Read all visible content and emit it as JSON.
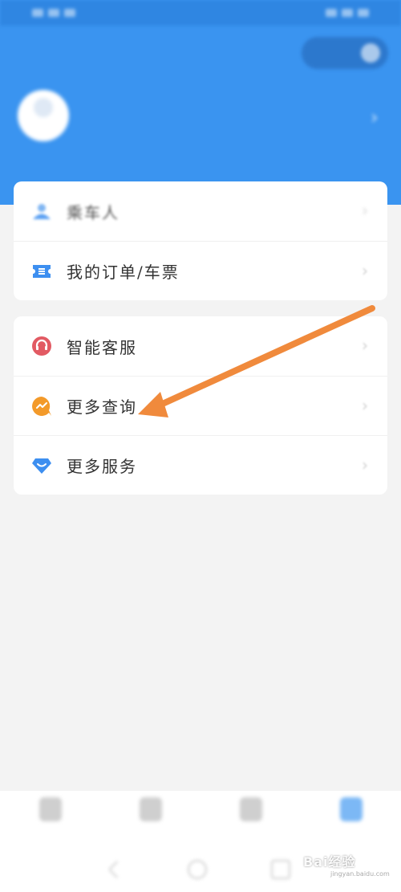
{
  "status_bar": {
    "left": "",
    "right": ""
  },
  "header": {
    "title": "",
    "pill_label": ""
  },
  "profile": {
    "name": "",
    "subtitle": ""
  },
  "menu_group_1": [
    {
      "label": "乘车人",
      "icon": "passenger-icon"
    },
    {
      "label": "我的订单/车票",
      "icon": "ticket-icon"
    }
  ],
  "menu_group_2": [
    {
      "label": "智能客服",
      "icon": "headset-icon"
    },
    {
      "label": "更多查询",
      "icon": "chart-bubble-icon"
    },
    {
      "label": "更多服务",
      "icon": "diamond-icon"
    }
  ],
  "bottom_nav": [
    {
      "label": "",
      "active": false
    },
    {
      "label": "",
      "active": false
    },
    {
      "label": "",
      "active": false
    },
    {
      "label": "",
      "active": true
    }
  ],
  "watermark": {
    "main": "Bai经验",
    "sub": "jingyan.baidu.com"
  },
  "colors": {
    "header_blue": "#3a94f0",
    "headset_red": "#e25a63",
    "query_orange": "#f39a2a",
    "ticket_blue": "#3d8ff0",
    "arrow_orange": "#f08a3c"
  }
}
